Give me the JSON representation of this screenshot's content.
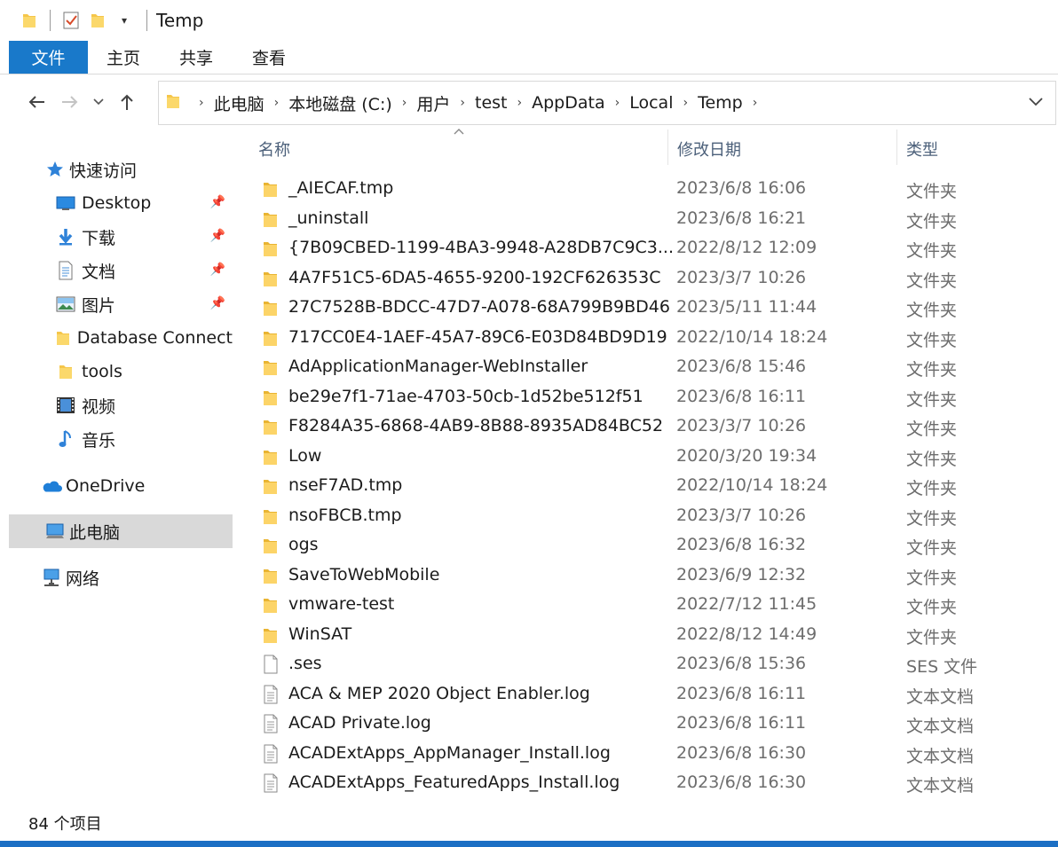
{
  "title": "Temp",
  "ribbon_tabs": [
    "文件",
    "主页",
    "共享",
    "查看"
  ],
  "breadcrumb": [
    "此电脑",
    "本地磁盘 (C:)",
    "用户",
    "test",
    "AppData",
    "Local",
    "Temp"
  ],
  "sidebar": {
    "quick_access_label": "快速访问",
    "items": [
      {
        "label": "Desktop",
        "icon": "desktop-icon",
        "pinned": true
      },
      {
        "label": "下载",
        "icon": "download-icon",
        "pinned": true
      },
      {
        "label": "文档",
        "icon": "document-icon",
        "pinned": true
      },
      {
        "label": "图片",
        "icon": "pictures-icon",
        "pinned": true
      },
      {
        "label": "Database Connect",
        "icon": "folder-icon",
        "pinned": false
      },
      {
        "label": "tools",
        "icon": "folder-icon",
        "pinned": false
      },
      {
        "label": "视频",
        "icon": "video-icon",
        "pinned": false
      },
      {
        "label": "音乐",
        "icon": "music-icon",
        "pinned": false
      }
    ],
    "onedrive_label": "OneDrive",
    "this_pc_label": "此电脑",
    "network_label": "网络"
  },
  "columns": {
    "name": "名称",
    "date": "修改日期",
    "type": "类型"
  },
  "files": [
    {
      "name": "_AIECAF.tmp",
      "date": "2023/6/8 16:06",
      "type": "文件夹",
      "kind": "folder"
    },
    {
      "name": "_uninstall",
      "date": "2023/6/8 16:21",
      "type": "文件夹",
      "kind": "folder"
    },
    {
      "name": "{7B09CBED-1199-4BA3-9948-A28DB7C9C3...",
      "date": "2022/8/12 12:09",
      "type": "文件夹",
      "kind": "folder"
    },
    {
      "name": "4A7F51C5-6DA5-4655-9200-192CF626353C",
      "date": "2023/3/7 10:26",
      "type": "文件夹",
      "kind": "folder"
    },
    {
      "name": "27C7528B-BDCC-47D7-A078-68A799B9BD46",
      "date": "2023/5/11 11:44",
      "type": "文件夹",
      "kind": "folder"
    },
    {
      "name": "717CC0E4-1AEF-45A7-89C6-E03D84BD9D19",
      "date": "2022/10/14 18:24",
      "type": "文件夹",
      "kind": "folder"
    },
    {
      "name": "AdApplicationManager-WebInstaller",
      "date": "2023/6/8 15:46",
      "type": "文件夹",
      "kind": "folder"
    },
    {
      "name": "be29e7f1-71ae-4703-50cb-1d52be512f51",
      "date": "2023/6/8 16:11",
      "type": "文件夹",
      "kind": "folder"
    },
    {
      "name": "F8284A35-6868-4AB9-8B88-8935AD84BC52",
      "date": "2023/3/7 10:26",
      "type": "文件夹",
      "kind": "folder"
    },
    {
      "name": "Low",
      "date": "2020/3/20 19:34",
      "type": "文件夹",
      "kind": "folder"
    },
    {
      "name": "nseF7AD.tmp",
      "date": "2022/10/14 18:24",
      "type": "文件夹",
      "kind": "folder"
    },
    {
      "name": "nsoFBCB.tmp",
      "date": "2023/3/7 10:26",
      "type": "文件夹",
      "kind": "folder"
    },
    {
      "name": "ogs",
      "date": "2023/6/8 16:32",
      "type": "文件夹",
      "kind": "folder"
    },
    {
      "name": "SaveToWebMobile",
      "date": "2023/6/9 12:32",
      "type": "文件夹",
      "kind": "folder"
    },
    {
      "name": "vmware-test",
      "date": "2022/7/12 11:45",
      "type": "文件夹",
      "kind": "folder"
    },
    {
      "name": "WinSAT",
      "date": "2022/8/12 14:49",
      "type": "文件夹",
      "kind": "folder"
    },
    {
      "name": ".ses",
      "date": "2023/6/8 15:36",
      "type": "SES 文件",
      "kind": "file"
    },
    {
      "name": "ACA & MEP 2020 Object Enabler.log",
      "date": "2023/6/8 16:11",
      "type": "文本文档",
      "kind": "text"
    },
    {
      "name": "ACAD Private.log",
      "date": "2023/6/8 16:11",
      "type": "文本文档",
      "kind": "text"
    },
    {
      "name": "ACADExtApps_AppManager_Install.log",
      "date": "2023/6/8 16:30",
      "type": "文本文档",
      "kind": "text"
    },
    {
      "name": "ACADExtApps_FeaturedApps_Install.log",
      "date": "2023/6/8 16:30",
      "type": "文本文档",
      "kind": "text"
    }
  ],
  "status_text": "84 个项目",
  "colors": {
    "accent": "#1979ca",
    "selected_bg": "#d9d9d9",
    "folder": "#f5c64a",
    "header_text": "#4c607a"
  }
}
